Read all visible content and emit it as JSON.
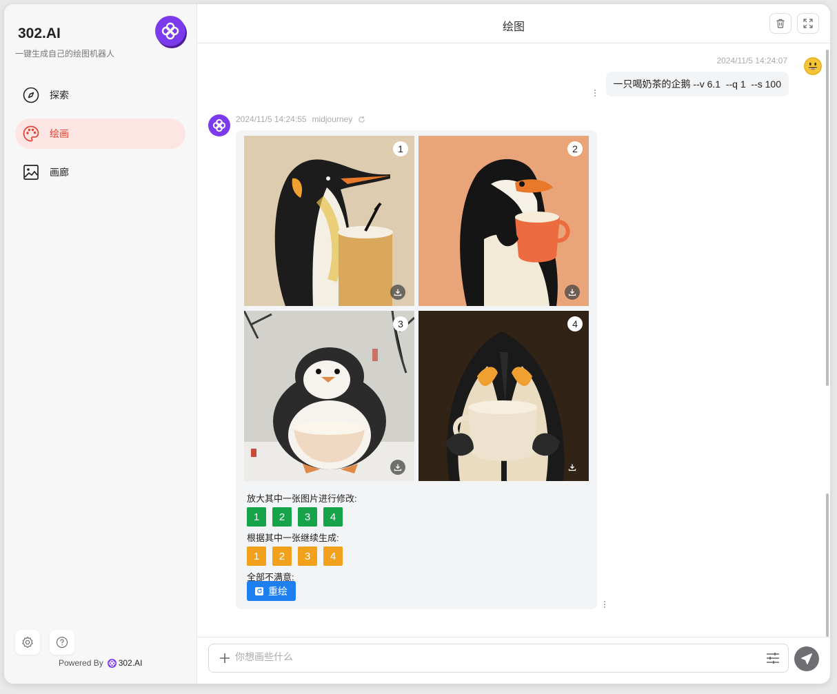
{
  "sidebar": {
    "brand_title": "302.AI",
    "brand_subtitle": "一键生成自己的绘图机器人",
    "items": [
      {
        "label": "探索",
        "icon": "compass-icon"
      },
      {
        "label": "绘画",
        "icon": "palette-icon",
        "active": true
      },
      {
        "label": "画廊",
        "icon": "image-icon"
      }
    ],
    "bottom_icons": [
      "gear-icon",
      "help-icon"
    ],
    "powered_by_prefix": "Powered By",
    "powered_by_brand": "302.AI"
  },
  "header": {
    "title": "绘图",
    "buttons": [
      "trash-icon",
      "fullscreen-icon"
    ]
  },
  "chat": {
    "user_message": {
      "time": "2024/11/5 14:24:07",
      "text": "一只喝奶茶的企鹅 --v 6.1  --q 1  --s 100",
      "avatar": "smiley-emoji-icon"
    },
    "bot_message": {
      "time": "2024/11/5 14:24:55",
      "model": "midjourney",
      "images": [
        {
          "number": "1",
          "subject": "penguin with iced milk tea cup"
        },
        {
          "number": "2",
          "subject": "penguin holding orange mug"
        },
        {
          "number": "3",
          "subject": "chubby penguin with bowl in snow"
        },
        {
          "number": "4",
          "subject": "penguin drinking from white cup"
        }
      ],
      "upscale_label": "放大其中一张图片进行修改:",
      "upscale_buttons": [
        "1",
        "2",
        "3",
        "4"
      ],
      "variation_label": "根据其中一张继续生成:",
      "variation_buttons": [
        "1",
        "2",
        "3",
        "4"
      ],
      "reroll_label": "全部不满意:",
      "reroll_button": "重绘"
    }
  },
  "composer": {
    "placeholder": "你想画些什么",
    "value": ""
  },
  "colors": {
    "brand_purple": "#7c3aed",
    "active_red": "#e1412d",
    "upscale_green": "#16a34a",
    "variation_orange": "#f2a11d",
    "reroll_blue": "#1e7ff0"
  }
}
